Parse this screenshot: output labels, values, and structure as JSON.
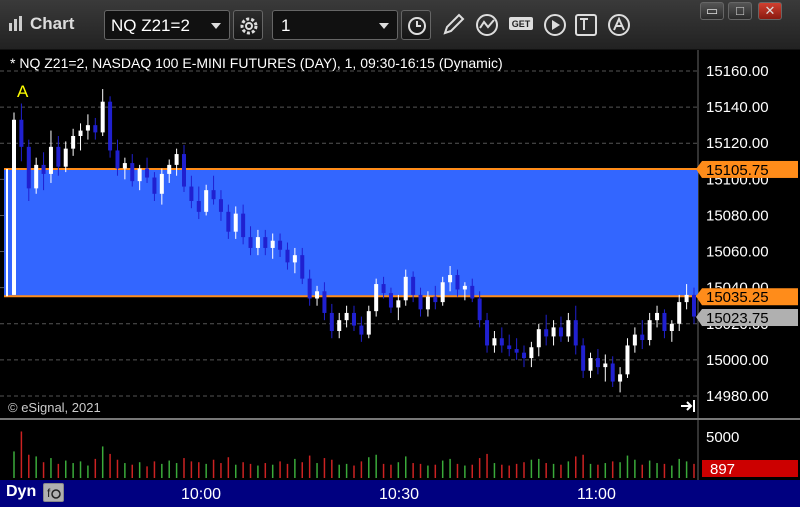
{
  "app": {
    "title": "Chart"
  },
  "toolbar": {
    "symbol": "NQ Z21=2",
    "interval": "1",
    "icons": [
      "symbol-settings-icon",
      "clock-icon",
      "pencil-icon",
      "studies-icon",
      "get-icon",
      "play-icon",
      "text-tool-icon",
      "alert-icon"
    ],
    "window_buttons": [
      "restore-icon",
      "maximize-icon",
      "close-icon"
    ]
  },
  "chart": {
    "header": "* NQ Z21=2, NASDAQ 100 E-MINI FUTURES (DAY), 1, 09:30-16:15 (Dynamic)",
    "copyright": "© eSignal, 2021",
    "marker_label": "A",
    "price_ticks": [
      "15160.00",
      "15140.00",
      "15120.00",
      "15100.00",
      "15080.00",
      "15060.00",
      "15040.00",
      "15020.00",
      "15000.00",
      "14980.00"
    ],
    "level_high": "15105.75",
    "level_low": "15035.25",
    "last_price": "15023.75",
    "volume_tick": "5000",
    "volume_last": "897",
    "time_labels": [
      "10:00",
      "10:30",
      "11:00"
    ],
    "bottom_label": "Dyn",
    "colors": {
      "band": "#3366ff",
      "level_line": "#ff8c1a",
      "up_candle": "#ffffff",
      "down_candle": "#2020d0",
      "last_price_bg": "#b0b0b0",
      "volume_last_bg": "#cc0000",
      "panel_bg": "#000080"
    }
  },
  "chart_data": {
    "type": "candlestick",
    "ylim": [
      14970,
      15170
    ],
    "candles": [
      [
        15036,
        15137,
        15036,
        15133
      ],
      [
        15133,
        15142,
        15110,
        15118
      ],
      [
        15118,
        15122,
        15088,
        15095
      ],
      [
        15095,
        15112,
        15092,
        15108
      ],
      [
        15108,
        15115,
        15094,
        15103
      ],
      [
        15103,
        15127,
        15098,
        15118
      ],
      [
        15118,
        15124,
        15102,
        15107
      ],
      [
        15107,
        15121,
        15104,
        15117
      ],
      [
        15117,
        15128,
        15113,
        15124
      ],
      [
        15124,
        15131,
        15116,
        15127
      ],
      [
        15127,
        15136,
        15122,
        15130
      ],
      [
        15130,
        15134,
        15122,
        15126
      ],
      [
        15126,
        15150,
        15124,
        15143
      ],
      [
        15143,
        15146,
        15112,
        15116
      ],
      [
        15116,
        15122,
        15102,
        15106
      ],
      [
        15106,
        15112,
        15100,
        15109
      ],
      [
        15109,
        15114,
        15096,
        15099
      ],
      [
        15099,
        15108,
        15094,
        15106
      ],
      [
        15106,
        15112,
        15098,
        15101
      ],
      [
        15101,
        15104,
        15088,
        15092
      ],
      [
        15092,
        15106,
        15086,
        15103
      ],
      [
        15103,
        15111,
        15098,
        15108
      ],
      [
        15108,
        15117,
        15102,
        15114
      ],
      [
        15114,
        15119,
        15093,
        15096
      ],
      [
        15096,
        15102,
        15084,
        15088
      ],
      [
        15088,
        15096,
        15078,
        15082
      ],
      [
        15082,
        15097,
        15080,
        15094
      ],
      [
        15094,
        15102,
        15086,
        15089
      ],
      [
        15089,
        15094,
        15077,
        15082
      ],
      [
        15082,
        15086,
        15067,
        15071
      ],
      [
        15071,
        15085,
        15067,
        15081
      ],
      [
        15081,
        15086,
        15064,
        15068
      ],
      [
        15068,
        15074,
        15058,
        15062
      ],
      [
        15062,
        15072,
        15058,
        15068
      ],
      [
        15068,
        15072,
        15058,
        15062
      ],
      [
        15062,
        15070,
        15056,
        15066
      ],
      [
        15066,
        15070,
        15057,
        15061
      ],
      [
        15061,
        15065,
        15050,
        15054
      ],
      [
        15054,
        15062,
        15048,
        15058
      ],
      [
        15058,
        15062,
        15042,
        15045
      ],
      [
        15045,
        15050,
        15030,
        15034
      ],
      [
        15034,
        15041,
        15030,
        15038
      ],
      [
        15038,
        15043,
        15022,
        15026
      ],
      [
        15026,
        15031,
        15012,
        15016
      ],
      [
        15016,
        15026,
        15012,
        15022
      ],
      [
        15022,
        15030,
        15018,
        15026
      ],
      [
        15026,
        15030,
        15016,
        15019
      ],
      [
        15019,
        15024,
        15010,
        15014
      ],
      [
        15014,
        15030,
        15012,
        15027
      ],
      [
        15027,
        15045,
        15024,
        15042
      ],
      [
        15042,
        15046,
        15034,
        15037
      ],
      [
        15037,
        15040,
        15026,
        15029
      ],
      [
        15029,
        15036,
        15022,
        15033
      ],
      [
        15033,
        15050,
        15030,
        15046
      ],
      [
        15046,
        15049,
        15032,
        15036
      ],
      [
        15036,
        15040,
        15024,
        15028
      ],
      [
        15028,
        15038,
        15024,
        15035
      ],
      [
        15035,
        15041,
        15028,
        15032
      ],
      [
        15032,
        15046,
        15030,
        15043
      ],
      [
        15043,
        15052,
        15038,
        15047
      ],
      [
        15047,
        15050,
        15035,
        15039
      ],
      [
        15039,
        15043,
        15033,
        15041
      ],
      [
        15041,
        15045,
        15032,
        15034
      ],
      [
        15034,
        15038,
        15018,
        15022
      ],
      [
        15022,
        15026,
        15004,
        15008
      ],
      [
        15008,
        15016,
        15004,
        15012
      ],
      [
        15012,
        15018,
        15004,
        15008
      ],
      [
        15008,
        15014,
        15002,
        15006
      ],
      [
        15006,
        15012,
        15000,
        15004
      ],
      [
        15004,
        15008,
        14996,
        15001
      ],
      [
        15001,
        15010,
        14996,
        15007
      ],
      [
        15007,
        15020,
        15002,
        15017
      ],
      [
        15017,
        15025,
        15008,
        15013
      ],
      [
        15013,
        15022,
        15008,
        15018
      ],
      [
        15018,
        15024,
        15010,
        15013
      ],
      [
        15013,
        15026,
        15010,
        15022
      ],
      [
        15022,
        15030,
        15003,
        15008
      ],
      [
        15008,
        15012,
        14990,
        14994
      ],
      [
        14994,
        15004,
        14990,
        15001
      ],
      [
        15001,
        15006,
        14992,
        14996
      ],
      [
        14996,
        15003,
        14988,
        14998
      ],
      [
        14998,
        15002,
        14985,
        14988
      ],
      [
        14988,
        14996,
        14982,
        14992
      ],
      [
        14992,
        15012,
        14990,
        15008
      ],
      [
        15008,
        15018,
        15004,
        15014
      ],
      [
        15014,
        15022,
        15006,
        15011
      ],
      [
        15011,
        15026,
        15008,
        15022
      ],
      [
        15022,
        15030,
        15018,
        15026
      ],
      [
        15026,
        15028,
        15012,
        15016
      ],
      [
        15016,
        15022,
        15010,
        15020
      ],
      [
        15020,
        15036,
        15016,
        15032
      ],
      [
        15032,
        15042,
        15028,
        15036
      ],
      [
        15036,
        15040,
        15020,
        15024
      ]
    ],
    "volume": [
      3200,
      5600,
      2800,
      2600,
      1900,
      2400,
      1700,
      2100,
      1800,
      2000,
      1500,
      2300,
      3800,
      2900,
      2200,
      1800,
      1600,
      1900,
      1400,
      2000,
      1700,
      2100,
      1800,
      2400,
      2000,
      1900,
      1700,
      2200,
      1800,
      2500,
      1600,
      1900,
      1700,
      1500,
      1800,
      1600,
      2000,
      1700,
      2300,
      1900,
      2700,
      1800,
      2400,
      2200,
      1600,
      1700,
      1500,
      2000,
      2500,
      2800,
      1700,
      1600,
      1900,
      2600,
      1800,
      1700,
      1500,
      1600,
      2100,
      2300,
      1700,
      1500,
      1600,
      2400,
      2900,
      1800,
      1600,
      1500,
      1700,
      1900,
      2200,
      2300,
      1800,
      1700,
      1600,
      2000,
      2600,
      2800,
      1700,
      1600,
      1800,
      2000,
      1900,
      2700,
      2200,
      1600,
      2100,
      1800,
      1700,
      1500,
      2300,
      2000,
      1700
    ],
    "volume_ylim": [
      0,
      6500
    ]
  }
}
